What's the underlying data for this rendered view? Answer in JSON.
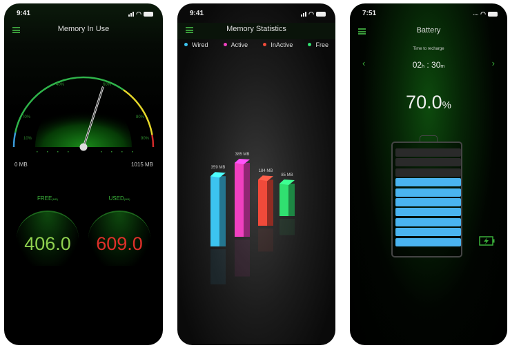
{
  "memory_in_use": {
    "status_time": "9:41",
    "title": "Memory In Use",
    "gauge": {
      "percent_labels": [
        "10%",
        "70%",
        "40%",
        "60%",
        "80%",
        "90%"
      ],
      "min_label": "0 MB",
      "max_label": "1015 MB",
      "used_mb": 609.0,
      "total_mb": 1015,
      "arc_colors": {
        "low": "#3a9ad9",
        "normal": "#2fb34a",
        "warning": "#e6d82a",
        "critical": "#d22a2a"
      }
    },
    "free": {
      "label": "FREE",
      "unit": "(MB)",
      "value": "406.0",
      "color": "#8fd14f"
    },
    "used": {
      "label": "USED",
      "unit": "(MB)",
      "value": "609.0",
      "color": "#e0302a"
    }
  },
  "memory_statistics": {
    "status_time": "9:41",
    "title": "Memory Statistics",
    "chart_data": {
      "type": "bar",
      "categories": [
        "Wired",
        "Active",
        "InActive",
        "Free"
      ],
      "values": [
        359,
        385,
        184,
        85
      ],
      "data_labels": [
        "359 MB",
        "385 MB",
        "184 MB",
        "85 MB"
      ],
      "colors": [
        "#3cc4f0",
        "#f040c0",
        "#f04a3a",
        "#30e070"
      ],
      "legend": "top"
    }
  },
  "battery": {
    "status_time": "7:51",
    "title": "Battery",
    "recharge_label": "Time to recharge",
    "hours": "02",
    "hours_unit": "h",
    "separator": ":",
    "minutes": "30",
    "minutes_unit": "m",
    "level_value": "70.0",
    "level_unit": "%",
    "level_fraction": 0.7,
    "cells_total": 10,
    "cell_color": "#4ab4f0",
    "charging_icon_color": "#3ab03a"
  }
}
